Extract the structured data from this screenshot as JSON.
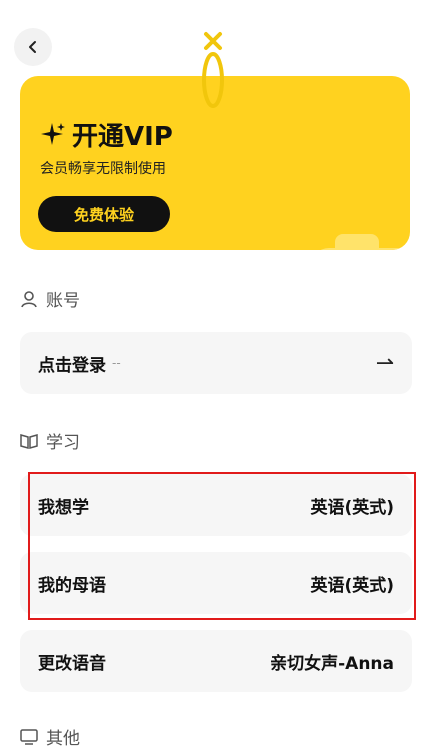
{
  "back": {
    "icon": "chevron-left-icon"
  },
  "vip": {
    "title": "开通VIP",
    "subtitle": "会员畅享无限制使用",
    "button": "免费体验",
    "accent": "#FFD21F"
  },
  "sections": {
    "account": {
      "label": "账号",
      "icon": "user-icon"
    },
    "study": {
      "label": "学习",
      "icon": "book-icon"
    },
    "other": {
      "label": "其他",
      "icon": "monitor-icon"
    }
  },
  "account_row": {
    "label": "点击登录",
    "dash": "--",
    "arrow": "⇀"
  },
  "study_rows": [
    {
      "label": "我想学",
      "value": "英语(英式)"
    },
    {
      "label": "我的母语",
      "value": "英语(英式)"
    },
    {
      "label": "更改语音",
      "value": "亲切女声-Anna"
    }
  ]
}
